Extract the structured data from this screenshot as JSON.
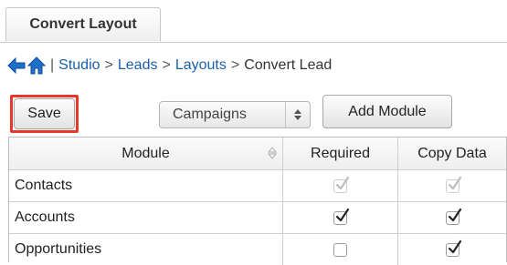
{
  "tab": {
    "label": "Convert Layout"
  },
  "breadcrumb": {
    "sep": ">",
    "bar": "|",
    "items": [
      "Studio",
      "Leads",
      "Layouts"
    ],
    "current": "Convert Lead"
  },
  "toolbar": {
    "save_label": "Save",
    "module_select_value": "Campaigns",
    "add_module_label": "Add Module"
  },
  "table": {
    "headers": {
      "module": "Module",
      "required": "Required",
      "copy_data": "Copy Data"
    },
    "rows": [
      {
        "module": "Contacts",
        "required": true,
        "required_disabled": true,
        "copy_data": true,
        "copy_disabled": true
      },
      {
        "module": "Accounts",
        "required": true,
        "required_disabled": false,
        "copy_data": true,
        "copy_disabled": false
      },
      {
        "module": "Opportunities",
        "required": false,
        "required_disabled": false,
        "copy_data": true,
        "copy_disabled": false
      }
    ]
  },
  "colors": {
    "link": "#1a61a8",
    "highlight": "#e8372b",
    "back_arrow": "#1f6fc9",
    "home_icon": "#1f6fc9"
  },
  "icons": {
    "back": "back-arrow-icon",
    "home": "home-icon",
    "sort": "sort-icon",
    "select": "select-arrows-icon"
  }
}
